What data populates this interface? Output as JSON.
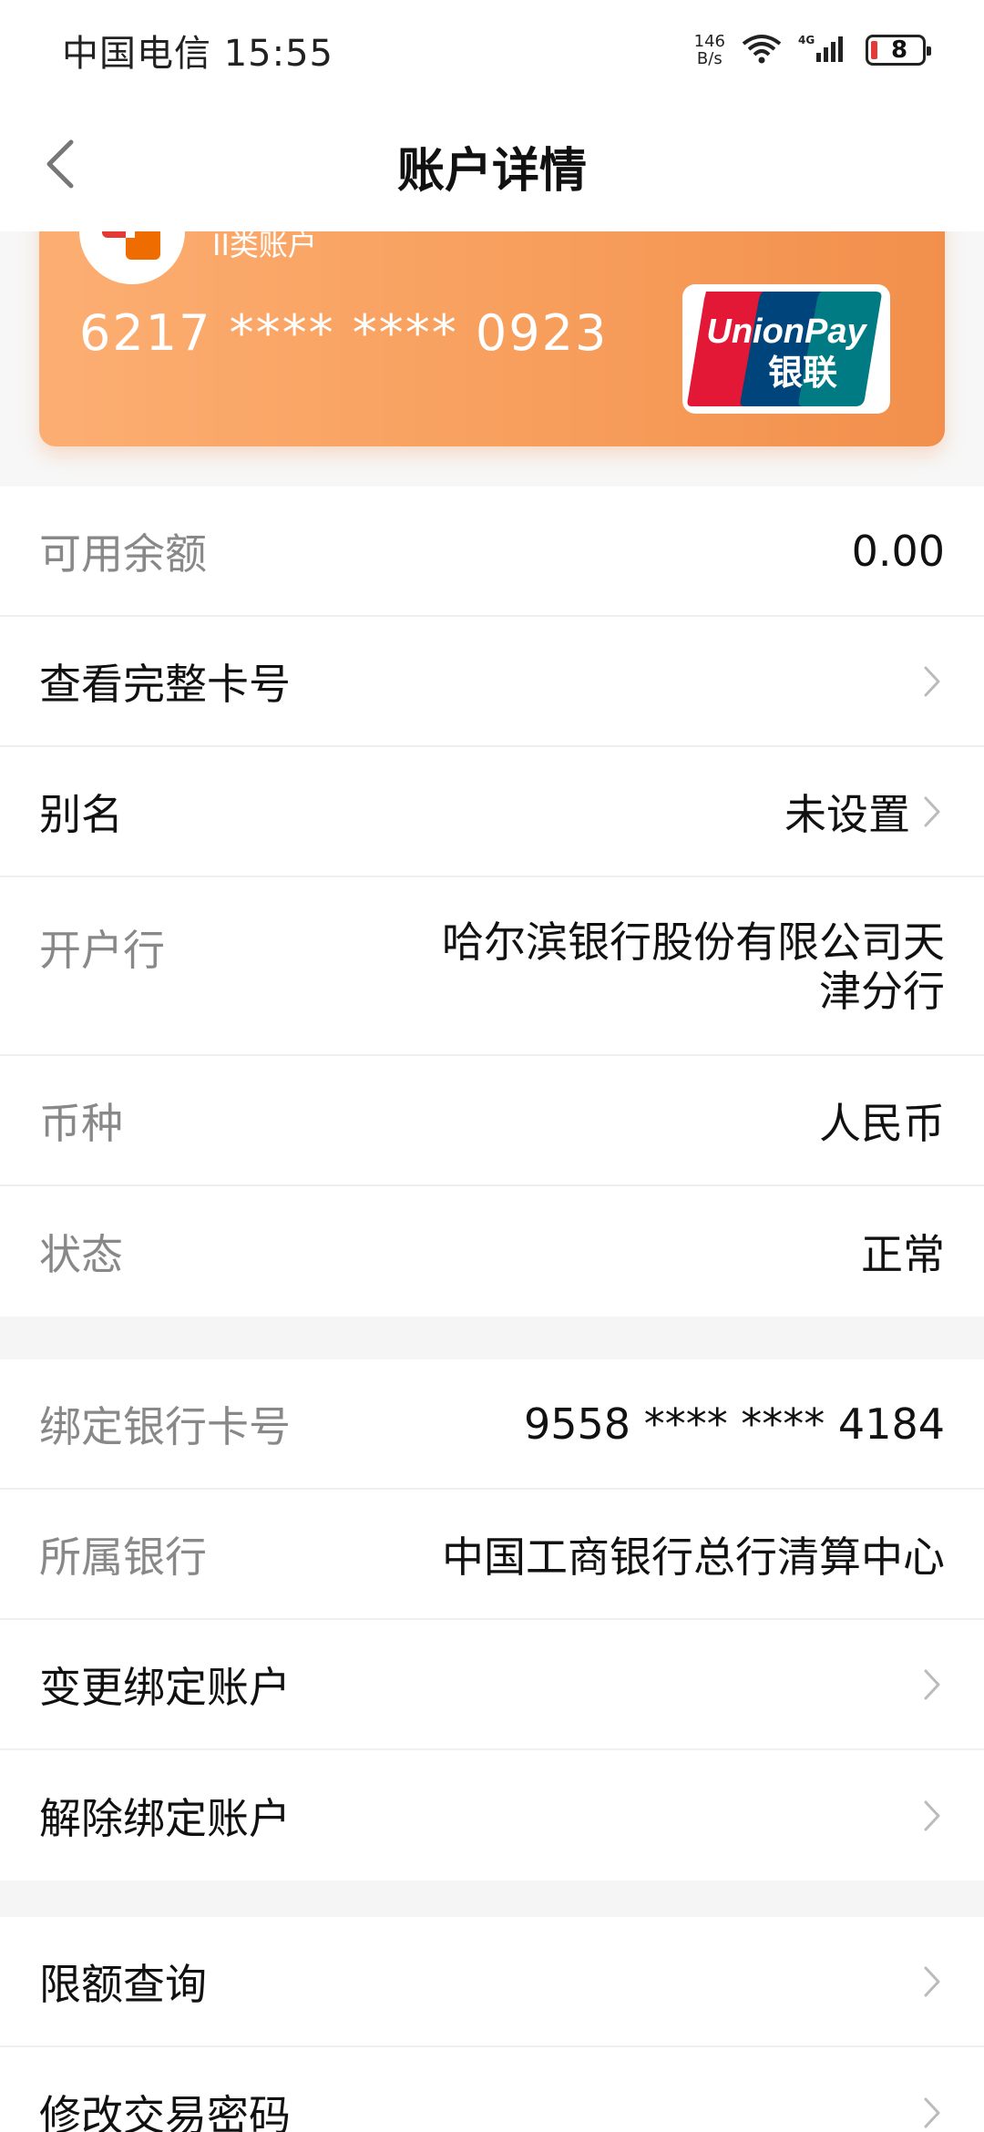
{
  "status_bar": {
    "carrier_time": "中国电信 15:55",
    "net_speed_value": "146",
    "net_speed_unit": "B/s",
    "battery": "8"
  },
  "nav": {
    "title": "账户详情"
  },
  "card": {
    "account_type": "II类账户",
    "card_number": "6217 **** **** 0923",
    "brand": "UnionPay",
    "brand_cn": "银联"
  },
  "section1": {
    "rows": [
      {
        "label": "可用余额",
        "value": "0.00"
      },
      {
        "label": "查看完整卡号",
        "value": ""
      },
      {
        "label": "别名",
        "value": "未设置"
      },
      {
        "label": "开户行",
        "value": "哈尔滨银行股份有限公司天津分行"
      },
      {
        "label": "币种",
        "value": "人民币"
      },
      {
        "label": "状态",
        "value": "正常"
      }
    ]
  },
  "section2": {
    "rows": [
      {
        "label": "绑定银行卡号",
        "value": "9558 **** **** 4184"
      },
      {
        "label": "所属银行",
        "value": "中国工商银行总行清算中心"
      },
      {
        "label": "变更绑定账户",
        "value": ""
      },
      {
        "label": "解除绑定账户",
        "value": ""
      }
    ]
  },
  "section3": {
    "rows": [
      {
        "label": "限额查询",
        "value": ""
      },
      {
        "label": "修改交易密码",
        "value": ""
      }
    ]
  },
  "colors": {
    "card_gradient_start": "#fcae72",
    "card_gradient_end": "#f28f4c",
    "label_gray": "#888888",
    "text_dark": "#111111"
  }
}
